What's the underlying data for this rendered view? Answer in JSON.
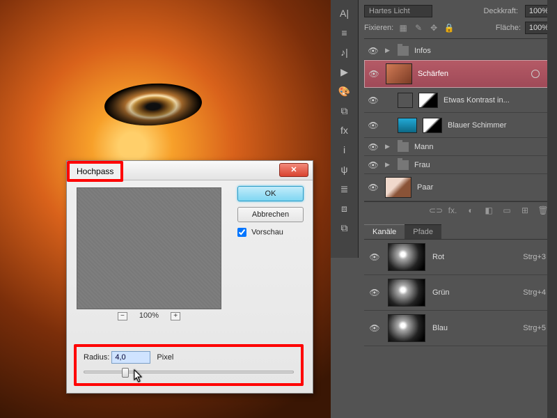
{
  "dialog": {
    "title": "Hochpass",
    "close": "✕",
    "ok": "OK",
    "cancel": "Abbrechen",
    "preview_label": "Vorschau",
    "zoom": "100%",
    "zoom_minus": "−",
    "zoom_plus": "+",
    "radius_label": "Radius:",
    "radius_value": "4,0",
    "radius_unit": "Pixel",
    "slider_percent": 18
  },
  "blend": {
    "mode_label": "",
    "mode_value": "Hartes Licht",
    "opacity_label": "Deckkraft:",
    "opacity_value": "100%",
    "lock_label": "Fixieren:",
    "fill_label": "Fläche:",
    "fill_value": "100%"
  },
  "layers": [
    {
      "kind": "group",
      "name": "Infos"
    },
    {
      "kind": "selected",
      "name": "Schärfen"
    },
    {
      "kind": "adjust",
      "name": "Etwas Kontrast in..."
    },
    {
      "kind": "adjust_blue",
      "name": "Blauer Schimmer"
    },
    {
      "kind": "group",
      "name": "Mann"
    },
    {
      "kind": "group",
      "name": "Frau"
    },
    {
      "kind": "smart",
      "name": "Paar"
    }
  ],
  "footer_icons": [
    "⊂⊃",
    "fx.",
    "◐",
    "◧",
    "▭",
    "⊞",
    "🗑"
  ],
  "channel_tabs": {
    "channels": "Kanäle",
    "paths": "Pfade"
  },
  "channels": [
    {
      "name": "Rot",
      "shortcut": "Strg+3"
    },
    {
      "name": "Grün",
      "shortcut": "Strg+4"
    },
    {
      "name": "Blau",
      "shortcut": "Strg+5"
    }
  ],
  "tool_icons": [
    "A|",
    "≡",
    "♪|",
    "▶",
    "🎨",
    "⧉",
    "fx",
    "i",
    "ψ",
    "≣",
    "⧈",
    "⧉"
  ]
}
